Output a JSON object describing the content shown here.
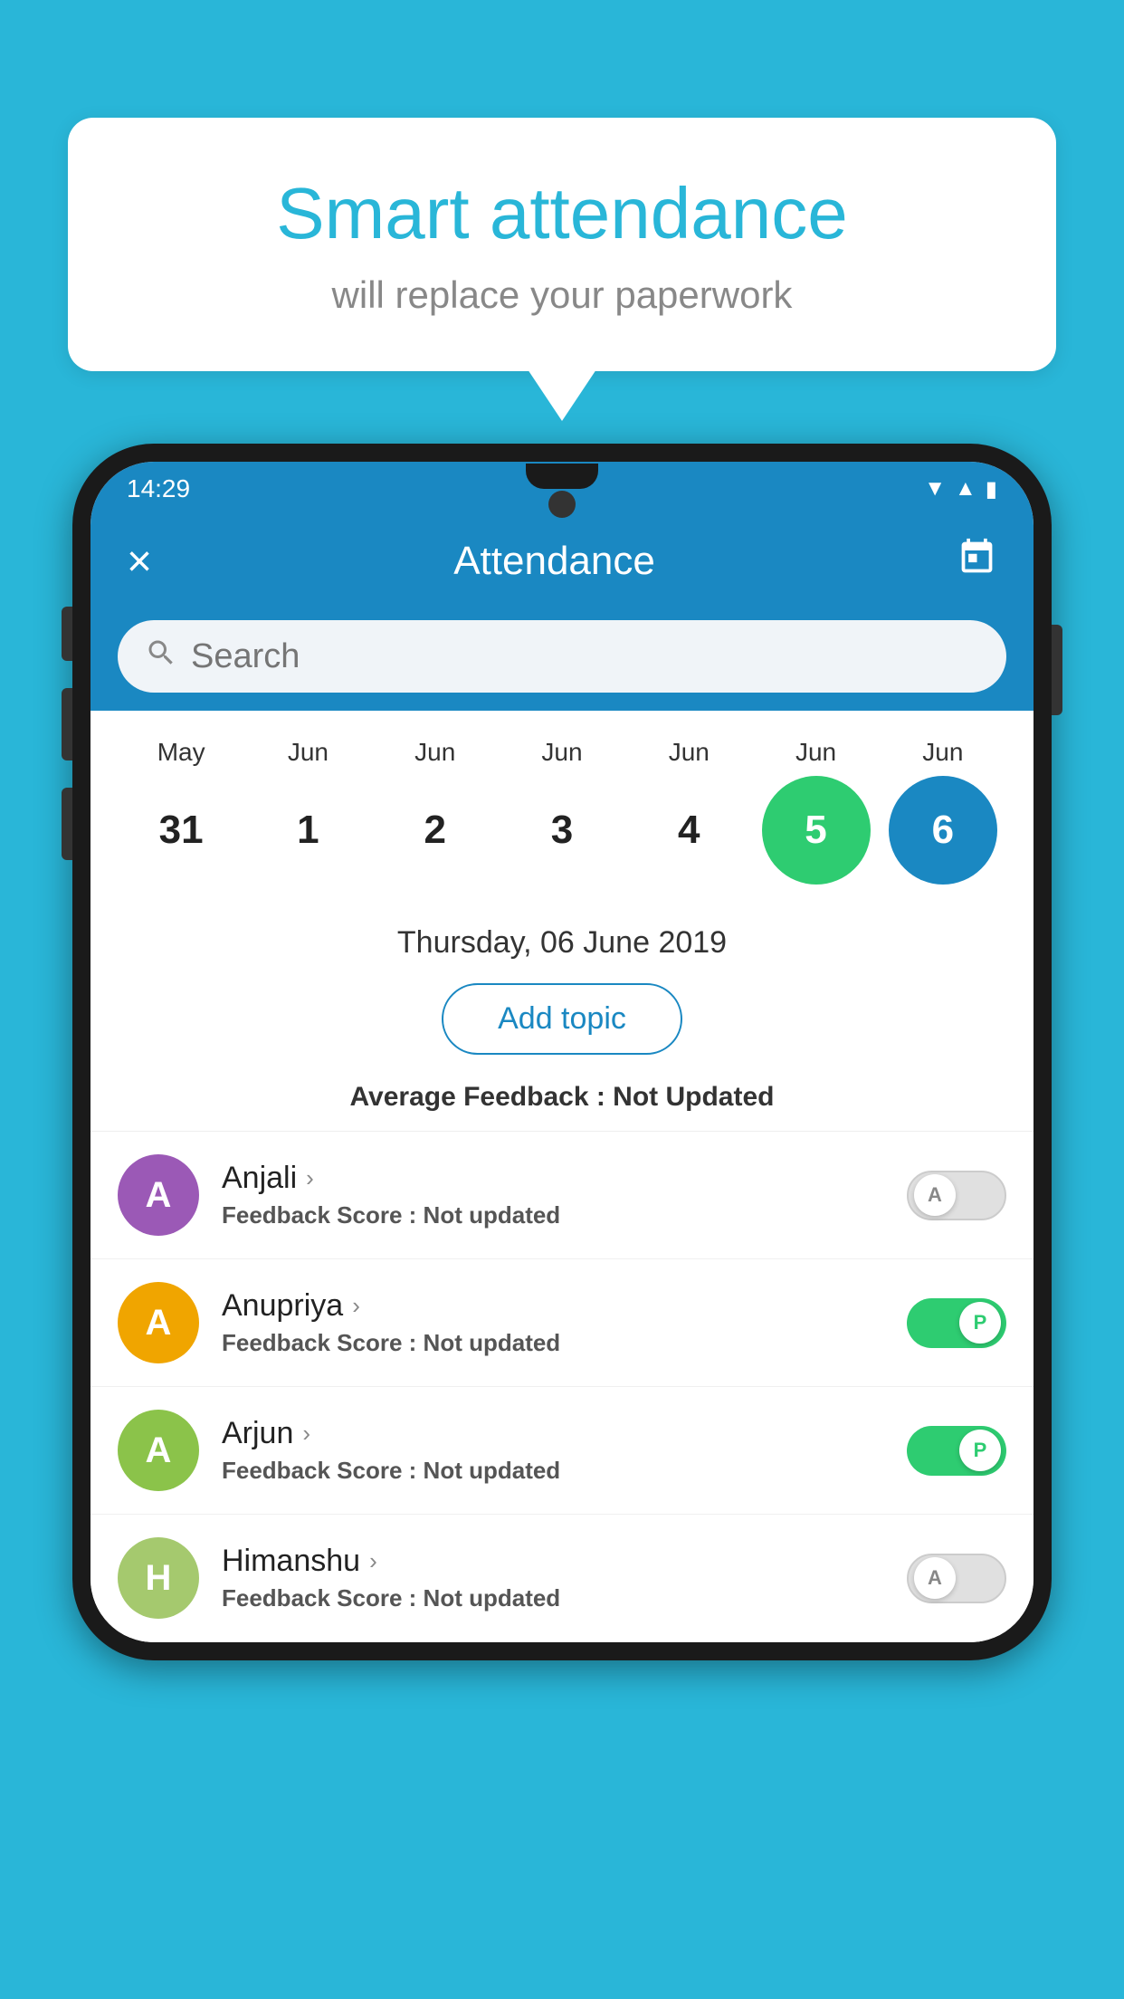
{
  "background_color": "#29b6d8",
  "speech_bubble": {
    "title": "Smart attendance",
    "subtitle": "will replace your paperwork"
  },
  "status_bar": {
    "time": "14:29",
    "icons": [
      "wifi",
      "signal",
      "battery"
    ]
  },
  "app_bar": {
    "close_label": "×",
    "title": "Attendance",
    "calendar_icon": "📅"
  },
  "search": {
    "placeholder": "Search"
  },
  "calendar": {
    "months": [
      "May",
      "Jun",
      "Jun",
      "Jun",
      "Jun",
      "Jun",
      "Jun"
    ],
    "dates": [
      {
        "day": "31",
        "state": "normal"
      },
      {
        "day": "1",
        "state": "normal"
      },
      {
        "day": "2",
        "state": "normal"
      },
      {
        "day": "3",
        "state": "normal"
      },
      {
        "day": "4",
        "state": "normal"
      },
      {
        "day": "5",
        "state": "today"
      },
      {
        "day": "6",
        "state": "selected"
      }
    ]
  },
  "selected_date": "Thursday, 06 June 2019",
  "add_topic_label": "Add topic",
  "avg_feedback": {
    "label": "Average Feedback : ",
    "value": "Not Updated"
  },
  "students": [
    {
      "name": "Anjali",
      "avatar_letter": "A",
      "avatar_color": "#9b59b6",
      "feedback_label": "Feedback Score : ",
      "feedback_value": "Not updated",
      "toggle_state": "off",
      "toggle_letter": "A"
    },
    {
      "name": "Anupriya",
      "avatar_letter": "A",
      "avatar_color": "#f0a500",
      "feedback_label": "Feedback Score : ",
      "feedback_value": "Not updated",
      "toggle_state": "on",
      "toggle_letter": "P"
    },
    {
      "name": "Arjun",
      "avatar_letter": "A",
      "avatar_color": "#8bc34a",
      "feedback_label": "Feedback Score : ",
      "feedback_value": "Not updated",
      "toggle_state": "on",
      "toggle_letter": "P"
    },
    {
      "name": "Himanshu",
      "avatar_letter": "H",
      "avatar_color": "#a5c96e",
      "feedback_label": "Feedback Score : ",
      "feedback_value": "Not updated",
      "toggle_state": "off",
      "toggle_letter": "A"
    }
  ]
}
